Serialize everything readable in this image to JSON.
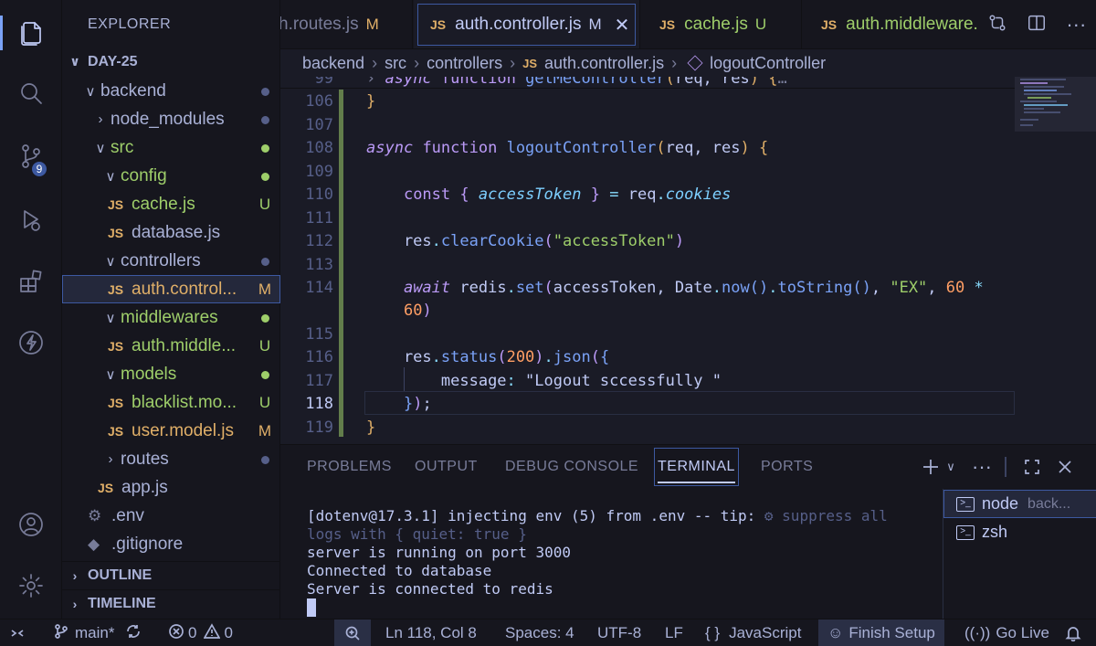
{
  "activity_bar": {
    "icons": [
      "explorer-icon",
      "search-icon",
      "source-control-icon",
      "run-debug-icon",
      "extensions-icon",
      "lightning-icon",
      "account-icon",
      "settings-icon"
    ],
    "source_control_badge": "9"
  },
  "sidebar": {
    "title": "EXPLORER",
    "root": "DAY-25",
    "items": [
      {
        "label": "backend",
        "status": "dot"
      },
      {
        "label": "node_modules",
        "status": "dot"
      },
      {
        "label": "src",
        "status": "dot"
      },
      {
        "label": "config",
        "status": "dot"
      },
      {
        "label": "cache.js",
        "status": "U"
      },
      {
        "label": "database.js",
        "status": ""
      },
      {
        "label": "controllers",
        "status": "dot"
      },
      {
        "label": "auth.control...",
        "status": "M"
      },
      {
        "label": "middlewares",
        "status": "dot"
      },
      {
        "label": "auth.middle...",
        "status": "U"
      },
      {
        "label": "models",
        "status": "dot"
      },
      {
        "label": "blacklist.mo...",
        "status": "U"
      },
      {
        "label": "user.model.js",
        "status": "M"
      },
      {
        "label": "routes",
        "status": "dot"
      },
      {
        "label": "app.js",
        "status": ""
      },
      {
        "label": ".env",
        "status": ""
      },
      {
        "label": ".gitignore",
        "status": ""
      }
    ],
    "file_icon_text": "JS",
    "outline": "OUTLINE",
    "timeline": "TIMELINE"
  },
  "tabs": [
    {
      "label": "h.routes.js",
      "mark": "M"
    },
    {
      "label": "auth.controller.js",
      "mark": "M"
    },
    {
      "label": "cache.js",
      "mark": "U"
    },
    {
      "label": "auth.middleware.",
      "mark": ""
    }
  ],
  "breadcrumb": [
    "backend",
    "src",
    "controllers",
    "auth.controller.js",
    "logoutController"
  ],
  "editor": {
    "line_numbers": [
      "99",
      "106",
      "107",
      "108",
      "109",
      "110",
      "111",
      "112",
      "113",
      "114",
      "115",
      "116",
      "117",
      "118",
      "119"
    ],
    "sticky_line": "async function getMeController(req, res) {",
    "current_line": "118"
  },
  "panel": {
    "tabs": [
      "PROBLEMS",
      "OUTPUT",
      "DEBUG CONSOLE",
      "TERMINAL",
      "PORTS"
    ],
    "active_tab": "TERMINAL",
    "terminal_lines": [
      "[dotenv@17.3.1] injecting env (5) from .env -- tip: ",
      "⚙ suppress all",
      "logs with { quiet: true }",
      "server is running on port 3000",
      "Connected to database",
      "Server is connected to redis"
    ],
    "terminals": [
      {
        "label": "node",
        "sub": "back..."
      },
      {
        "label": "zsh",
        "sub": ""
      }
    ]
  },
  "status_bar": {
    "branch": "main*",
    "errors": "0",
    "warnings": "0",
    "position": "Ln 118, Col 8",
    "spaces": "Spaces: 4",
    "encoding": "UTF-8",
    "eol": "LF",
    "language": "JavaScript",
    "language_icon": "{ }",
    "finish_setup": "Finish Setup",
    "go_live": "Go Live"
  },
  "colors": {
    "accent": "#3d59a1",
    "modified": "#e0af68",
    "untracked": "#9ece6a"
  }
}
